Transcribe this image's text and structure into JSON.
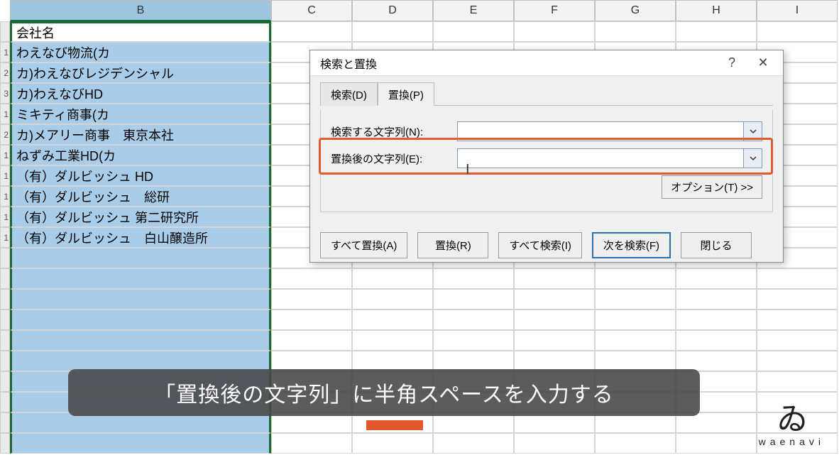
{
  "columns": [
    "B",
    "C",
    "D",
    "E",
    "F",
    "G",
    "H",
    "I"
  ],
  "rows": [
    {
      "n": "",
      "b": "会社名"
    },
    {
      "n": "1",
      "b": "わえなび物流(カ"
    },
    {
      "n": "2",
      "b": "カ)わえなびレジデンシャル"
    },
    {
      "n": "3",
      "b": "カ)わえなびHD"
    },
    {
      "n": "1",
      "b": "ミキティ商事(カ"
    },
    {
      "n": "2",
      "b": "カ)メアリー商事　東京本社"
    },
    {
      "n": "1",
      "b": "ねずみ工業HD(カ"
    },
    {
      "n": "1",
      "b": "（有）ダルビッシュ HD"
    },
    {
      "n": "1",
      "b": "（有）ダルビッシュ　総研"
    },
    {
      "n": "1",
      "b": "（有）ダルビッシュ 第二研究所"
    },
    {
      "n": "1",
      "b": "（有）ダルビッシュ　白山醸造所"
    },
    {
      "n": "",
      "b": ""
    },
    {
      "n": "",
      "b": ""
    },
    {
      "n": "",
      "b": ""
    },
    {
      "n": "",
      "b": ""
    },
    {
      "n": "",
      "b": ""
    },
    {
      "n": "",
      "b": ""
    },
    {
      "n": "",
      "b": ""
    },
    {
      "n": "",
      "b": ""
    },
    {
      "n": "",
      "b": ""
    },
    {
      "n": "",
      "b": ""
    }
  ],
  "dialog": {
    "title": "検索と置換",
    "tab_find": "検索(D)",
    "tab_replace": "置換(P)",
    "label_find": "検索する文字列(N):",
    "label_replace": "置換後の文字列(E):",
    "find_value": "",
    "replace_value": " ",
    "options_btn": "オプション(T) >>",
    "btn_replace_all": "すべて置換(A)",
    "btn_replace": "置換(R)",
    "btn_find_all": "すべて検索(I)",
    "btn_find_next": "次を検索(F)",
    "btn_close": "閉じる"
  },
  "caption": "「置換後の文字列」に半角スペースを入力する",
  "logo_text": "waenavi"
}
